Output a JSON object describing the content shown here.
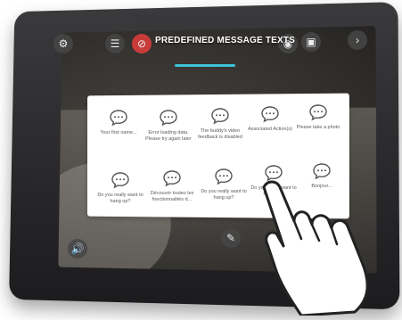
{
  "header": {
    "title": "PREDEFINED MESSAGE TEXTS"
  },
  "toolbar": {
    "buttons": [
      {
        "icon": "settings-icon"
      },
      {
        "icon": "sliders-icon"
      },
      {
        "icon": "camera-off-icon"
      },
      {
        "icon": "camera-icon"
      },
      {
        "icon": "gallery-icon"
      },
      {
        "icon": "chevron-right-icon"
      },
      {
        "icon": "speaker-icon"
      },
      {
        "icon": "edit-icon"
      }
    ],
    "accent_color": "#3fc3d6",
    "active_color": "#c93b3b"
  },
  "messages": [
    {
      "label": "Your first name..."
    },
    {
      "label": "Error loading data. Please try again later"
    },
    {
      "label": "The buddy's video feedback is disabled"
    },
    {
      "label": "Associated Action(s)"
    },
    {
      "label": "Please take a photo"
    },
    {
      "label": "Do you really want to hang up?"
    },
    {
      "label": "Découvrir toutes les fonctionnalités d..."
    },
    {
      "label": "Do you really want to hang up?"
    },
    {
      "label": "Do you really want to hang up?"
    },
    {
      "label": "Bonjour..."
    }
  ]
}
